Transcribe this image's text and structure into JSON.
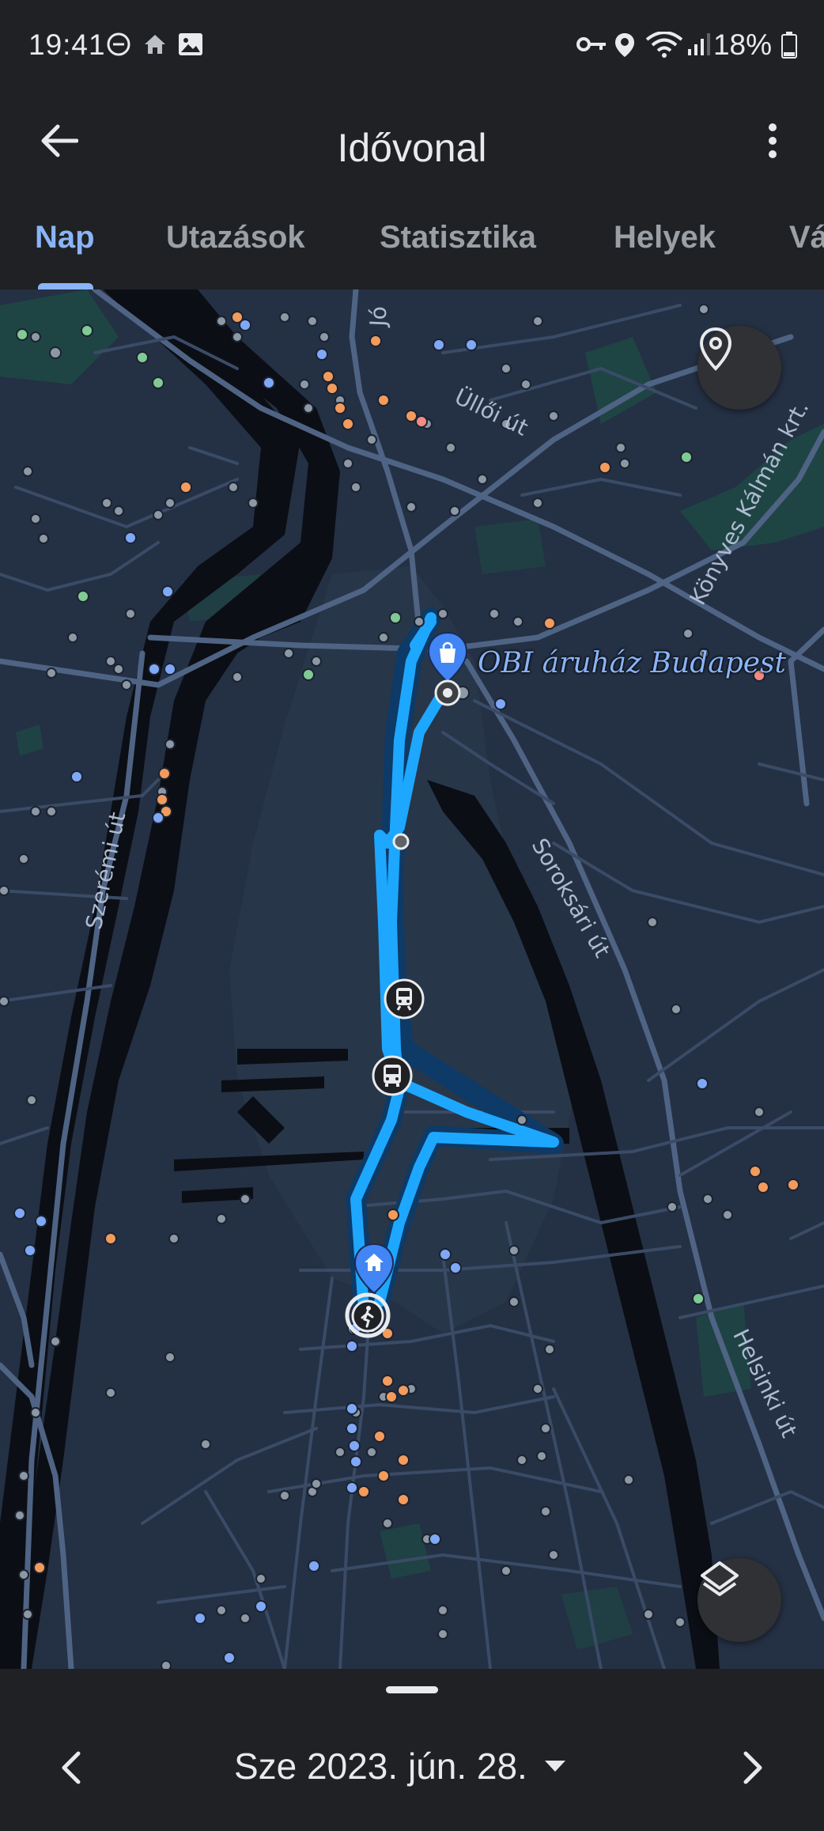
{
  "status_bar": {
    "time": "19:41",
    "battery": "18%",
    "icons": [
      "do-not-disturb-icon",
      "home-icon",
      "image-icon",
      "vpn-key-icon",
      "location-icon",
      "wifi-icon",
      "signal-icon",
      "battery-icon"
    ]
  },
  "app_bar": {
    "title": "Idővonal"
  },
  "tabs": [
    {
      "label": "Nap",
      "active": true
    },
    {
      "label": "Utazások",
      "active": false
    },
    {
      "label": "Statisztika",
      "active": false
    },
    {
      "label": "Helyek",
      "active": false
    },
    {
      "label": "Vá",
      "active": false
    }
  ],
  "map": {
    "place_label": "OBI áruház Budapest",
    "street_labels": [
      "Üllői út",
      "Könyves Kálmán krt.",
      "Soroksári út",
      "Szerémi út",
      "Helsinki út",
      "Jó"
    ],
    "route_color": "#1ea7ff",
    "markers": [
      "obi-store-pin",
      "home-pin",
      "train-stop",
      "bus-stop"
    ]
  },
  "date_nav": {
    "date": "Sze 2023. jún. 28."
  }
}
